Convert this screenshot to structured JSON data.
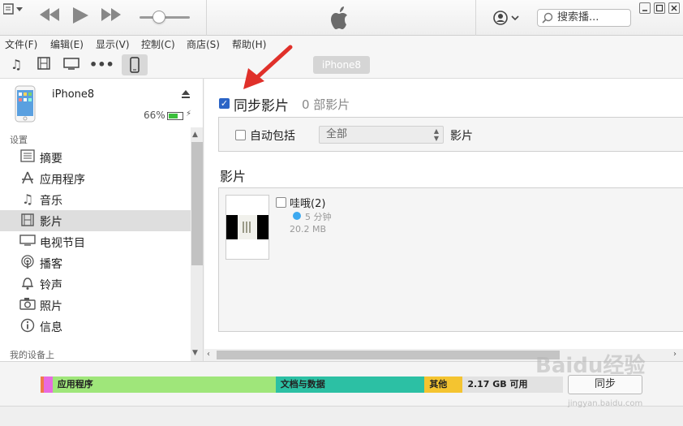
{
  "menu": [
    "文件(F)",
    "编辑(E)",
    "显示(V)",
    "控制(C)",
    "商店(S)",
    "帮助(H)"
  ],
  "search": {
    "placeholder": "搜索播..."
  },
  "volume": {
    "level": 0.4
  },
  "toolbar": {
    "device_name": "iPhone8"
  },
  "device": {
    "name": "iPhone8",
    "battery_percent": "66%",
    "battery_level": 0.66
  },
  "sidebar": {
    "settings_heading": "设置",
    "items": [
      {
        "label": "摘要",
        "icon": "summary-icon",
        "selected": false
      },
      {
        "label": "应用程序",
        "icon": "apps-icon",
        "selected": false
      },
      {
        "label": "音乐",
        "icon": "music-note-icon",
        "selected": false
      },
      {
        "label": "影片",
        "icon": "film-icon",
        "selected": true
      },
      {
        "label": "电视节目",
        "icon": "tv-icon",
        "selected": false
      },
      {
        "label": "播客",
        "icon": "podcast-icon",
        "selected": false
      },
      {
        "label": "铃声",
        "icon": "bell-icon",
        "selected": false
      },
      {
        "label": "照片",
        "icon": "camera-icon",
        "selected": false
      },
      {
        "label": "信息",
        "icon": "info-icon",
        "selected": false
      }
    ],
    "device_heading": "我的设备上"
  },
  "main": {
    "sync_label": "同步影片",
    "sync_checked": true,
    "movie_count": "0 部影片",
    "auto_include_label": "自动包括",
    "auto_include_value": "全部",
    "auto_include_suffix": "影片",
    "movies_heading": "影片",
    "movie": {
      "title": "哇哦(2)",
      "duration": "5 分钟",
      "size": "20.2 MB"
    }
  },
  "capacity": {
    "segments": [
      {
        "label": "",
        "color": "#f07a4a",
        "fraction": 0.006
      },
      {
        "label": "",
        "color": "#e86ae0",
        "fraction": 0.017
      },
      {
        "label": "应用程序",
        "color": "#9fe67a",
        "fraction": 0.427
      },
      {
        "label": "文档与数据",
        "color": "#2cc0a4",
        "fraction": 0.285
      },
      {
        "label": "其他",
        "color": "#f4c430",
        "fraction": 0.073
      },
      {
        "label": "2.17 GB 可用",
        "color": "#e2e2e2",
        "fraction": 0.192
      }
    ],
    "sync_button": "同步"
  },
  "watermark": {
    "brand": "Baidu经验",
    "url": "jingyan.baidu.com"
  }
}
